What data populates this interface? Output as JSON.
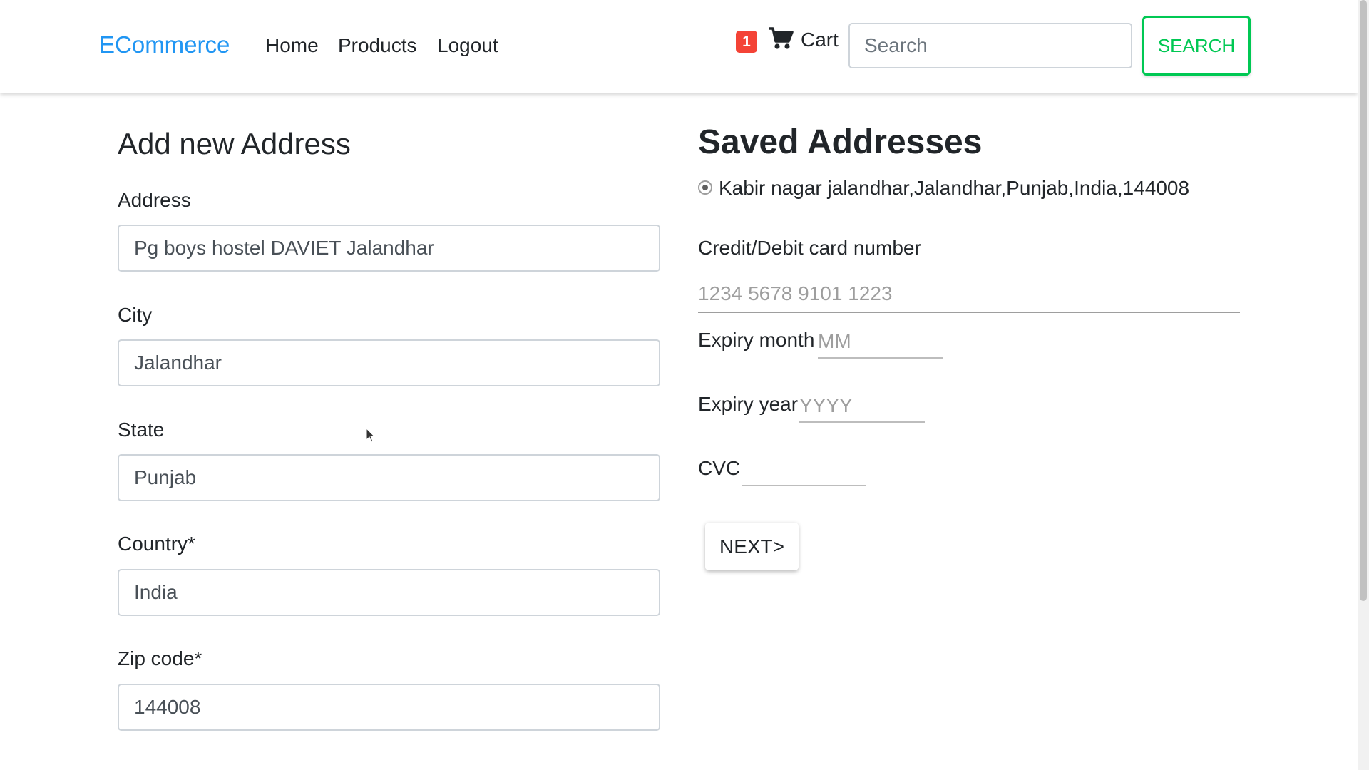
{
  "navbar": {
    "brand": "ECommerce",
    "links": [
      "Home",
      "Products",
      "Logout"
    ],
    "cart_count": "1",
    "cart_label": "Cart",
    "search_placeholder": "Search",
    "search_button": "SEARCH",
    "cart_icon": "shopping-cart-icon"
  },
  "add_address": {
    "title": "Add new Address",
    "fields": [
      {
        "label": "Address",
        "value": "Pg boys hostel DAVIET Jalandhar"
      },
      {
        "label": "City",
        "value": "Jalandhar"
      },
      {
        "label": "State",
        "value": "Punjab"
      },
      {
        "label": "Country*",
        "value": "India"
      },
      {
        "label": "Zip code*",
        "value": "144008"
      }
    ]
  },
  "saved_addresses": {
    "title": "Saved Addresses",
    "items": [
      {
        "text": "Kabir nagar jalandhar,Jalandhar,Punjab,India,144008",
        "selected": true
      }
    ]
  },
  "payment": {
    "card_label": "Credit/Debit card number",
    "card_placeholder": "1234 5678 9101 1223",
    "month_label": "Expiry month",
    "month_placeholder": "MM",
    "year_label": "Expiry year",
    "year_placeholder": "YYYY",
    "cvc_label": "CVC",
    "cvc_placeholder": "",
    "next_button": "NEXT>"
  },
  "colors": {
    "brand": "#2196f3",
    "search_accent": "#00c853",
    "badge": "#f44336"
  }
}
